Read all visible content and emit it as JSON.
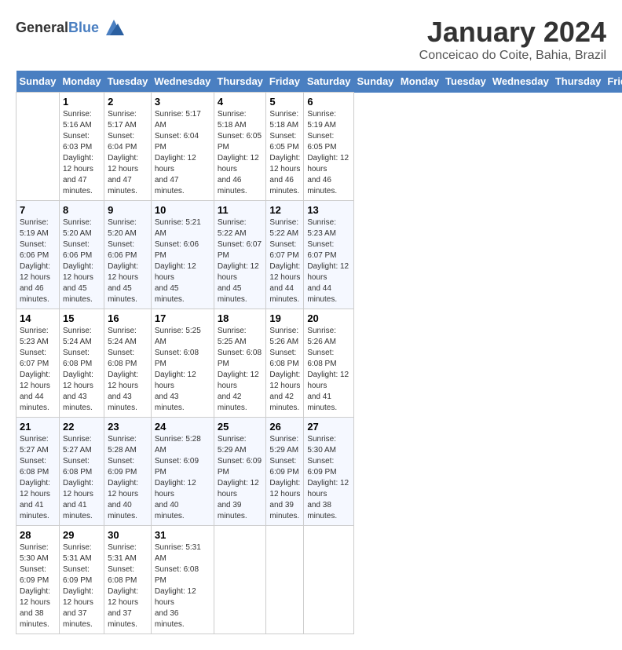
{
  "header": {
    "logo_general": "General",
    "logo_blue": "Blue",
    "month_title": "January 2024",
    "location": "Conceicao do Coite, Bahia, Brazil"
  },
  "calendar": {
    "days_of_week": [
      "Sunday",
      "Monday",
      "Tuesday",
      "Wednesday",
      "Thursday",
      "Friday",
      "Saturday"
    ],
    "weeks": [
      [
        {
          "day": "",
          "info": ""
        },
        {
          "day": "1",
          "info": "Sunrise: 5:16 AM\nSunset: 6:03 PM\nDaylight: 12 hours\nand 47 minutes."
        },
        {
          "day": "2",
          "info": "Sunrise: 5:17 AM\nSunset: 6:04 PM\nDaylight: 12 hours\nand 47 minutes."
        },
        {
          "day": "3",
          "info": "Sunrise: 5:17 AM\nSunset: 6:04 PM\nDaylight: 12 hours\nand 47 minutes."
        },
        {
          "day": "4",
          "info": "Sunrise: 5:18 AM\nSunset: 6:05 PM\nDaylight: 12 hours\nand 46 minutes."
        },
        {
          "day": "5",
          "info": "Sunrise: 5:18 AM\nSunset: 6:05 PM\nDaylight: 12 hours\nand 46 minutes."
        },
        {
          "day": "6",
          "info": "Sunrise: 5:19 AM\nSunset: 6:05 PM\nDaylight: 12 hours\nand 46 minutes."
        }
      ],
      [
        {
          "day": "7",
          "info": "Sunrise: 5:19 AM\nSunset: 6:06 PM\nDaylight: 12 hours\nand 46 minutes."
        },
        {
          "day": "8",
          "info": "Sunrise: 5:20 AM\nSunset: 6:06 PM\nDaylight: 12 hours\nand 45 minutes."
        },
        {
          "day": "9",
          "info": "Sunrise: 5:20 AM\nSunset: 6:06 PM\nDaylight: 12 hours\nand 45 minutes."
        },
        {
          "day": "10",
          "info": "Sunrise: 5:21 AM\nSunset: 6:06 PM\nDaylight: 12 hours\nand 45 minutes."
        },
        {
          "day": "11",
          "info": "Sunrise: 5:22 AM\nSunset: 6:07 PM\nDaylight: 12 hours\nand 45 minutes."
        },
        {
          "day": "12",
          "info": "Sunrise: 5:22 AM\nSunset: 6:07 PM\nDaylight: 12 hours\nand 44 minutes."
        },
        {
          "day": "13",
          "info": "Sunrise: 5:23 AM\nSunset: 6:07 PM\nDaylight: 12 hours\nand 44 minutes."
        }
      ],
      [
        {
          "day": "14",
          "info": "Sunrise: 5:23 AM\nSunset: 6:07 PM\nDaylight: 12 hours\nand 44 minutes."
        },
        {
          "day": "15",
          "info": "Sunrise: 5:24 AM\nSunset: 6:08 PM\nDaylight: 12 hours\nand 43 minutes."
        },
        {
          "day": "16",
          "info": "Sunrise: 5:24 AM\nSunset: 6:08 PM\nDaylight: 12 hours\nand 43 minutes."
        },
        {
          "day": "17",
          "info": "Sunrise: 5:25 AM\nSunset: 6:08 PM\nDaylight: 12 hours\nand 43 minutes."
        },
        {
          "day": "18",
          "info": "Sunrise: 5:25 AM\nSunset: 6:08 PM\nDaylight: 12 hours\nand 42 minutes."
        },
        {
          "day": "19",
          "info": "Sunrise: 5:26 AM\nSunset: 6:08 PM\nDaylight: 12 hours\nand 42 minutes."
        },
        {
          "day": "20",
          "info": "Sunrise: 5:26 AM\nSunset: 6:08 PM\nDaylight: 12 hours\nand 41 minutes."
        }
      ],
      [
        {
          "day": "21",
          "info": "Sunrise: 5:27 AM\nSunset: 6:08 PM\nDaylight: 12 hours\nand 41 minutes."
        },
        {
          "day": "22",
          "info": "Sunrise: 5:27 AM\nSunset: 6:08 PM\nDaylight: 12 hours\nand 41 minutes."
        },
        {
          "day": "23",
          "info": "Sunrise: 5:28 AM\nSunset: 6:09 PM\nDaylight: 12 hours\nand 40 minutes."
        },
        {
          "day": "24",
          "info": "Sunrise: 5:28 AM\nSunset: 6:09 PM\nDaylight: 12 hours\nand 40 minutes."
        },
        {
          "day": "25",
          "info": "Sunrise: 5:29 AM\nSunset: 6:09 PM\nDaylight: 12 hours\nand 39 minutes."
        },
        {
          "day": "26",
          "info": "Sunrise: 5:29 AM\nSunset: 6:09 PM\nDaylight: 12 hours\nand 39 minutes."
        },
        {
          "day": "27",
          "info": "Sunrise: 5:30 AM\nSunset: 6:09 PM\nDaylight: 12 hours\nand 38 minutes."
        }
      ],
      [
        {
          "day": "28",
          "info": "Sunrise: 5:30 AM\nSunset: 6:09 PM\nDaylight: 12 hours\nand 38 minutes."
        },
        {
          "day": "29",
          "info": "Sunrise: 5:31 AM\nSunset: 6:09 PM\nDaylight: 12 hours\nand 37 minutes."
        },
        {
          "day": "30",
          "info": "Sunrise: 5:31 AM\nSunset: 6:08 PM\nDaylight: 12 hours\nand 37 minutes."
        },
        {
          "day": "31",
          "info": "Sunrise: 5:31 AM\nSunset: 6:08 PM\nDaylight: 12 hours\nand 36 minutes."
        },
        {
          "day": "",
          "info": ""
        },
        {
          "day": "",
          "info": ""
        },
        {
          "day": "",
          "info": ""
        }
      ]
    ]
  }
}
